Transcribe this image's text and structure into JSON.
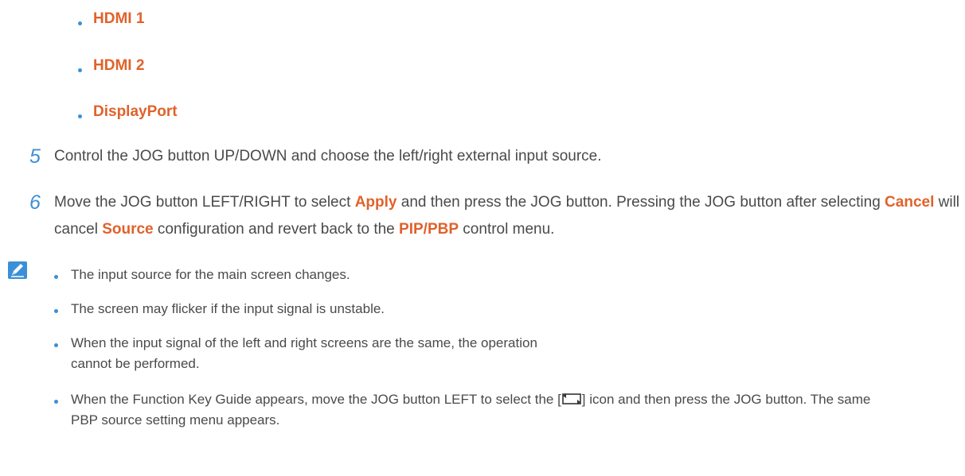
{
  "source_options": [
    "HDMI 1",
    "HDMI 2",
    "DisplayPort"
  ],
  "steps": {
    "step5": {
      "number": "5",
      "text": "Control the JOG button UP/DOWN and choose the left/right external input source."
    },
    "step6": {
      "number": "6",
      "part1": "Move the JOG button LEFT/RIGHT to select ",
      "apply": "Apply",
      "part2": " and then press the JOG button. Pressing the JOG button after selecting ",
      "cancel": "Cancel",
      "part3": " will cancel ",
      "source": "Source",
      "part4": " configuration and revert back to the ",
      "pipbbp": "PIP/PBP",
      "part5": " control menu."
    }
  },
  "notes": {
    "note1": "The input source for the main screen changes.",
    "note2": "The screen may flicker if the input signal is unstable.",
    "note3": "When the input signal of the left and right screens are the same, the operation cannot be performed.",
    "note4_part1": "When the Function Key Guide appears, move the JOG button LEFT to select the [",
    "note4_part2": "] icon and then press the JOG button. The same PBP source setting menu appears."
  },
  "colors": {
    "highlight": "#e0622b",
    "bullet": "#3b8fd6",
    "body_text": "#4a4a4a"
  },
  "icons": {
    "note": "note-pencil-icon",
    "inline": "pbp-window-icon"
  }
}
